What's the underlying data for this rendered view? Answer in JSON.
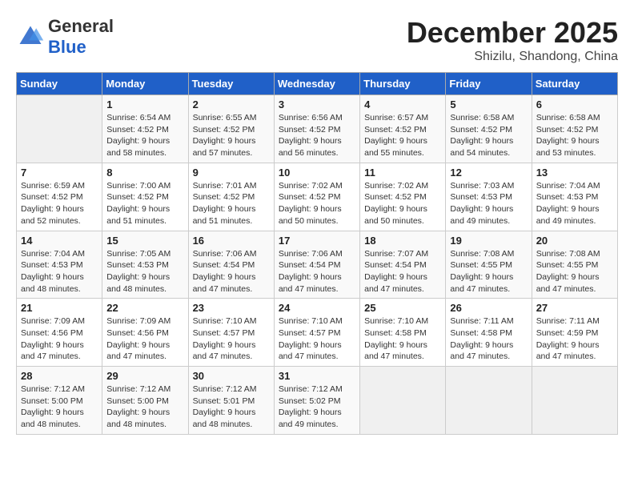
{
  "header": {
    "logo_general": "General",
    "logo_blue": "Blue",
    "month_title": "December 2025",
    "location": "Shizilu, Shandong, China"
  },
  "days_of_week": [
    "Sunday",
    "Monday",
    "Tuesday",
    "Wednesday",
    "Thursday",
    "Friday",
    "Saturday"
  ],
  "weeks": [
    [
      {
        "day": "",
        "info": ""
      },
      {
        "day": "1",
        "info": "Sunrise: 6:54 AM\nSunset: 4:52 PM\nDaylight: 9 hours\nand 58 minutes."
      },
      {
        "day": "2",
        "info": "Sunrise: 6:55 AM\nSunset: 4:52 PM\nDaylight: 9 hours\nand 57 minutes."
      },
      {
        "day": "3",
        "info": "Sunrise: 6:56 AM\nSunset: 4:52 PM\nDaylight: 9 hours\nand 56 minutes."
      },
      {
        "day": "4",
        "info": "Sunrise: 6:57 AM\nSunset: 4:52 PM\nDaylight: 9 hours\nand 55 minutes."
      },
      {
        "day": "5",
        "info": "Sunrise: 6:58 AM\nSunset: 4:52 PM\nDaylight: 9 hours\nand 54 minutes."
      },
      {
        "day": "6",
        "info": "Sunrise: 6:58 AM\nSunset: 4:52 PM\nDaylight: 9 hours\nand 53 minutes."
      }
    ],
    [
      {
        "day": "7",
        "info": "Sunrise: 6:59 AM\nSunset: 4:52 PM\nDaylight: 9 hours\nand 52 minutes."
      },
      {
        "day": "8",
        "info": "Sunrise: 7:00 AM\nSunset: 4:52 PM\nDaylight: 9 hours\nand 51 minutes."
      },
      {
        "day": "9",
        "info": "Sunrise: 7:01 AM\nSunset: 4:52 PM\nDaylight: 9 hours\nand 51 minutes."
      },
      {
        "day": "10",
        "info": "Sunrise: 7:02 AM\nSunset: 4:52 PM\nDaylight: 9 hours\nand 50 minutes."
      },
      {
        "day": "11",
        "info": "Sunrise: 7:02 AM\nSunset: 4:52 PM\nDaylight: 9 hours\nand 50 minutes."
      },
      {
        "day": "12",
        "info": "Sunrise: 7:03 AM\nSunset: 4:53 PM\nDaylight: 9 hours\nand 49 minutes."
      },
      {
        "day": "13",
        "info": "Sunrise: 7:04 AM\nSunset: 4:53 PM\nDaylight: 9 hours\nand 49 minutes."
      }
    ],
    [
      {
        "day": "14",
        "info": "Sunrise: 7:04 AM\nSunset: 4:53 PM\nDaylight: 9 hours\nand 48 minutes."
      },
      {
        "day": "15",
        "info": "Sunrise: 7:05 AM\nSunset: 4:53 PM\nDaylight: 9 hours\nand 48 minutes."
      },
      {
        "day": "16",
        "info": "Sunrise: 7:06 AM\nSunset: 4:54 PM\nDaylight: 9 hours\nand 47 minutes."
      },
      {
        "day": "17",
        "info": "Sunrise: 7:06 AM\nSunset: 4:54 PM\nDaylight: 9 hours\nand 47 minutes."
      },
      {
        "day": "18",
        "info": "Sunrise: 7:07 AM\nSunset: 4:54 PM\nDaylight: 9 hours\nand 47 minutes."
      },
      {
        "day": "19",
        "info": "Sunrise: 7:08 AM\nSunset: 4:55 PM\nDaylight: 9 hours\nand 47 minutes."
      },
      {
        "day": "20",
        "info": "Sunrise: 7:08 AM\nSunset: 4:55 PM\nDaylight: 9 hours\nand 47 minutes."
      }
    ],
    [
      {
        "day": "21",
        "info": "Sunrise: 7:09 AM\nSunset: 4:56 PM\nDaylight: 9 hours\nand 47 minutes."
      },
      {
        "day": "22",
        "info": "Sunrise: 7:09 AM\nSunset: 4:56 PM\nDaylight: 9 hours\nand 47 minutes."
      },
      {
        "day": "23",
        "info": "Sunrise: 7:10 AM\nSunset: 4:57 PM\nDaylight: 9 hours\nand 47 minutes."
      },
      {
        "day": "24",
        "info": "Sunrise: 7:10 AM\nSunset: 4:57 PM\nDaylight: 9 hours\nand 47 minutes."
      },
      {
        "day": "25",
        "info": "Sunrise: 7:10 AM\nSunset: 4:58 PM\nDaylight: 9 hours\nand 47 minutes."
      },
      {
        "day": "26",
        "info": "Sunrise: 7:11 AM\nSunset: 4:58 PM\nDaylight: 9 hours\nand 47 minutes."
      },
      {
        "day": "27",
        "info": "Sunrise: 7:11 AM\nSunset: 4:59 PM\nDaylight: 9 hours\nand 47 minutes."
      }
    ],
    [
      {
        "day": "28",
        "info": "Sunrise: 7:12 AM\nSunset: 5:00 PM\nDaylight: 9 hours\nand 48 minutes."
      },
      {
        "day": "29",
        "info": "Sunrise: 7:12 AM\nSunset: 5:00 PM\nDaylight: 9 hours\nand 48 minutes."
      },
      {
        "day": "30",
        "info": "Sunrise: 7:12 AM\nSunset: 5:01 PM\nDaylight: 9 hours\nand 48 minutes."
      },
      {
        "day": "31",
        "info": "Sunrise: 7:12 AM\nSunset: 5:02 PM\nDaylight: 9 hours\nand 49 minutes."
      },
      {
        "day": "",
        "info": ""
      },
      {
        "day": "",
        "info": ""
      },
      {
        "day": "",
        "info": ""
      }
    ]
  ]
}
